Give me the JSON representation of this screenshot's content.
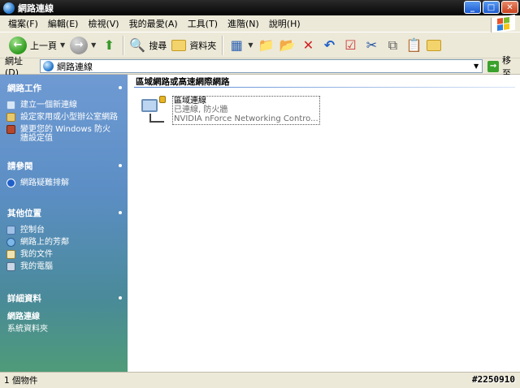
{
  "window": {
    "title": "網路連線"
  },
  "menu": [
    "檔案(F)",
    "編輯(E)",
    "檢視(V)",
    "我的最愛(A)",
    "工具(T)",
    "進階(N)",
    "說明(H)"
  ],
  "toolbar": {
    "back_label": "上一頁",
    "search_label": "搜尋",
    "folders_label": "資料夾"
  },
  "address": {
    "label": "網址(D)",
    "value": "網路連線",
    "go_label": "移至"
  },
  "taskpane": {
    "network_tasks": {
      "title": "網路工作",
      "items": [
        "建立一個新連線",
        "設定家用或小型辦公室網路",
        "變更您的 Windows 防火牆設定值"
      ]
    },
    "see_also": {
      "title": "請參閱",
      "items": [
        "網路疑難排解"
      ]
    },
    "other_places": {
      "title": "其他位置",
      "items": [
        "控制台",
        "網路上的芳鄰",
        "我的文件",
        "我的電腦"
      ]
    },
    "details": {
      "title": "詳細資料",
      "name": "網路連線",
      "subtitle": "系統資料夾"
    }
  },
  "content": {
    "group_header": "區域網路或高速網際網路",
    "connection": {
      "name": "區域連線",
      "status": "已連線, 防火牆",
      "device": "NVIDIA nForce Networking Contro..."
    }
  },
  "statusbar": {
    "text": "1 個物件",
    "watermark": "#2250910"
  },
  "colors": {
    "taskpane_top": "#6f9ad3",
    "taskpane_bottom": "#4e9b78",
    "chrome": "#ece9d8"
  }
}
